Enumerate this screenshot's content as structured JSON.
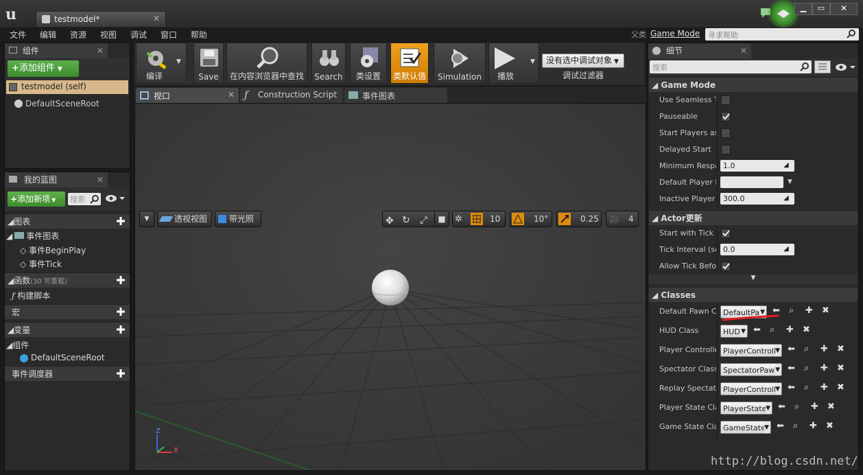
{
  "window": {
    "tab_title": "testmodel*",
    "watermark": "http://blog.csdn.net/"
  },
  "menu": {
    "items": [
      "文件",
      "编辑",
      "资源",
      "视图",
      "调试",
      "窗口",
      "帮助"
    ],
    "parent_label": "父类",
    "parent_value": "Game Mode",
    "help_placeholder": "寻求帮助"
  },
  "components_panel": {
    "tab": "组件",
    "add_button": "添加组件",
    "items": [
      "testmodel (self)",
      "DefaultSceneRoot"
    ]
  },
  "blueprint_panel": {
    "tab": "我的蓝图",
    "add_button": "添加新项",
    "search_placeholder": "搜索",
    "sections": {
      "graphs": "图表",
      "event_graph": "事件图表",
      "begin_play": "事件BeginPlay",
      "tick": "事件Tick",
      "functions": "函数",
      "functions_count": "(30 可重载)",
      "construction": "构建脚本",
      "macros": "宏",
      "variables": "变量",
      "components": "组件",
      "default_root": "DefaultSceneRoot",
      "dispatchers": "事件调度器"
    }
  },
  "toolbar": {
    "buttons": [
      "编译",
      "Save",
      "在内容浏览器中查找",
      "Search",
      "类设置",
      "类默认值",
      "Simulation",
      "播放"
    ],
    "debug_select": "没有选中调试对象",
    "debug_filter": "调试过滤器"
  },
  "editor_tabs": [
    "视口",
    "Construction Script",
    "事件图表"
  ],
  "viewport": {
    "perspective": "透视视图",
    "lit": "带光照",
    "grid_snap": "10",
    "rot_snap": "10°",
    "scale_snap": "0.25",
    "cam_speed": "4",
    "axis_x": "X",
    "axis_z": "Z"
  },
  "details": {
    "tab": "细节",
    "search_placeholder": "搜索",
    "game_mode": {
      "title": "Game Mode",
      "rows": [
        {
          "name": "Use Seamless T",
          "type": "check",
          "checked": false
        },
        {
          "name": "Pauseable",
          "type": "check",
          "checked": true
        },
        {
          "name": "Start Players as",
          "type": "check",
          "checked": false
        },
        {
          "name": "Delayed Start",
          "type": "check",
          "checked": false
        },
        {
          "name": "Minimum Respa",
          "type": "num",
          "value": "1.0"
        },
        {
          "name": "Default Player N",
          "type": "text",
          "value": ""
        },
        {
          "name": "Inactive Player S",
          "type": "num",
          "value": "300.0"
        }
      ]
    },
    "actor_tick": {
      "title": "Actor更新",
      "rows": [
        {
          "name": "Start with Tick E",
          "type": "check",
          "checked": true
        },
        {
          "name": "Tick Interval (se",
          "type": "num",
          "value": "0.0"
        },
        {
          "name": "Allow Tick Befor",
          "type": "check",
          "checked": true
        }
      ]
    },
    "classes": {
      "title": "Classes",
      "rows": [
        {
          "name": "Default Pawn Cla",
          "value": "DefaultPa"
        },
        {
          "name": "HUD Class",
          "value": "HUD"
        },
        {
          "name": "Player Controller",
          "value": "PlayerControlle"
        },
        {
          "name": "Spectator Class",
          "value": "SpectatorPawn"
        },
        {
          "name": "Replay Spectato",
          "value": "PlayerControlle"
        },
        {
          "name": "Player State Clas",
          "value": "PlayerState"
        },
        {
          "name": "Game State Clas",
          "value": "GameState"
        }
      ]
    }
  },
  "colors": {
    "accent_orange": "#e08a0c",
    "green": "#4aa53a",
    "selected": "#d8b88a"
  }
}
